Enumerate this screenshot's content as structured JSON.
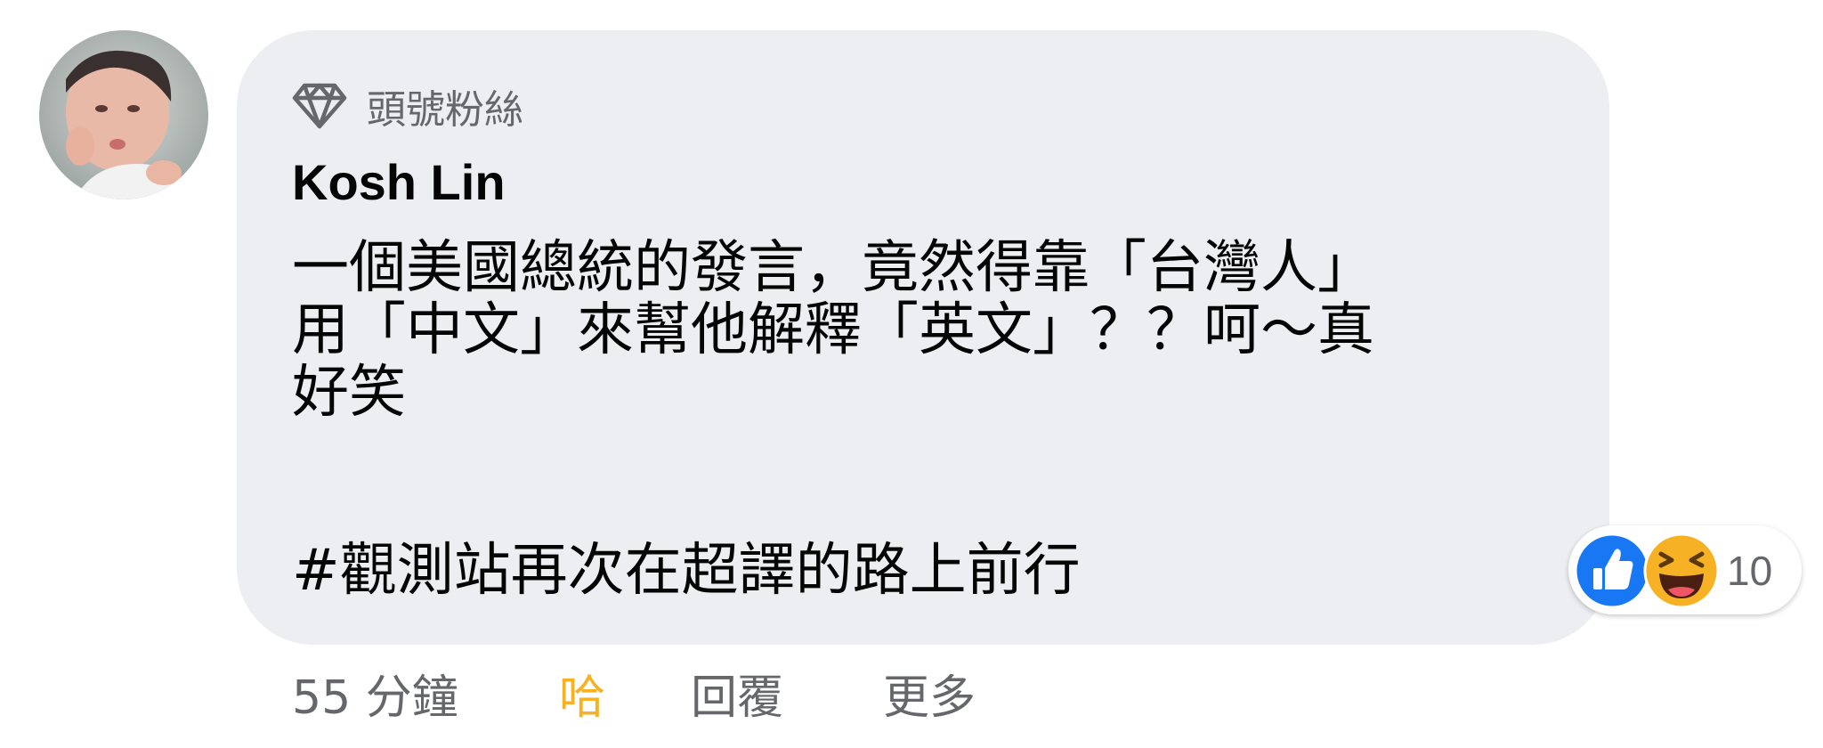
{
  "comment": {
    "badge_label": "頭號粉絲",
    "author": "Kosh Lin",
    "body_lines": [
      "一個美國總統的發言，竟然得靠「台灣人」",
      "用「中文」來幫他解釋「英文」？？呵～真",
      "好笑"
    ],
    "hashtag_line": "#觀測站再次在超譯的路上前行"
  },
  "reactions": {
    "icons": [
      "like-icon",
      "haha-icon"
    ],
    "count": "10"
  },
  "actions": {
    "time": "55 分鐘",
    "reaction_label": "哈",
    "reply": "回覆",
    "more": "更多"
  },
  "colors": {
    "bubble": "#eceef2",
    "text": "#050505",
    "secondary": "#65676b",
    "haha_accent": "#f7b125",
    "like_blue": "#1877f2"
  }
}
